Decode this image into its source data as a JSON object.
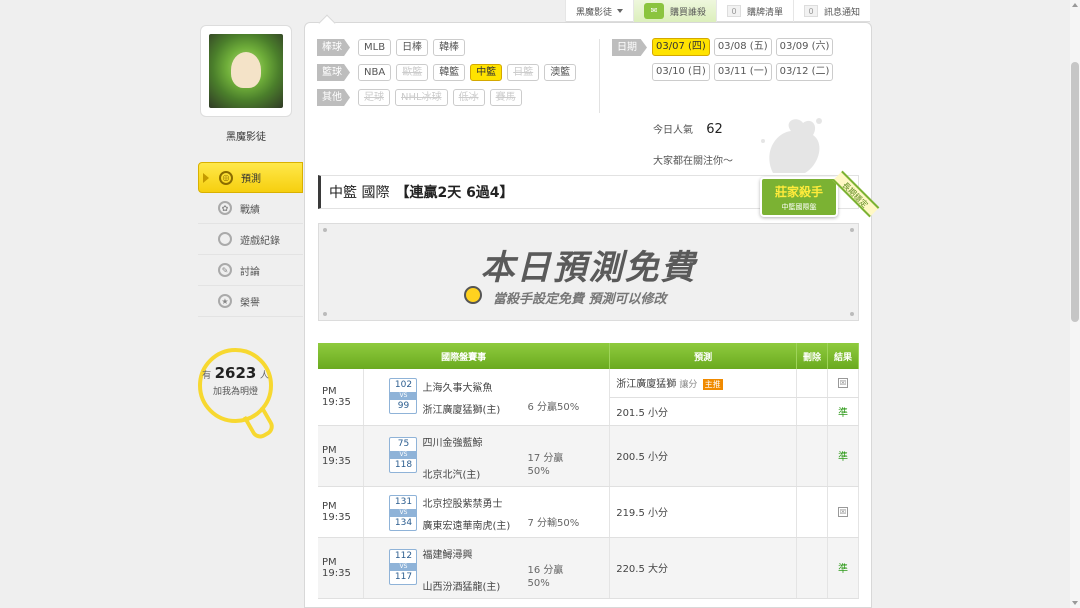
{
  "topbar": {
    "user_menu_label": "黑魔影徒",
    "buy_label": "購買誰殺",
    "cart_count": "0",
    "cart_label": "購牌清單",
    "notice_count": "0",
    "notice_label": "訊息通知"
  },
  "sidebar": {
    "username": "黑魔影徒",
    "nav": [
      {
        "label": "預測",
        "icon": "target-icon",
        "active": true
      },
      {
        "label": "戰績",
        "icon": "medal-icon",
        "active": false
      },
      {
        "label": "遊戲紀錄",
        "icon": "record-icon",
        "active": false
      },
      {
        "label": "討論",
        "icon": "discussion-icon",
        "active": false
      },
      {
        "label": "榮譽",
        "icon": "honor-icon",
        "active": false
      }
    ],
    "fans": {
      "prefix": "有",
      "count": "2623",
      "suffix": "人",
      "sub": "加我為明燈"
    }
  },
  "filters": {
    "baseball": {
      "label": "棒球",
      "items": [
        "MLB",
        "日棒",
        "韓棒"
      ]
    },
    "basketball": {
      "label": "籃球",
      "items": [
        "NBA",
        "歐籃",
        "韓籃",
        "中籃",
        "日籃",
        "澳籃"
      ],
      "disabled": [
        "歐籃",
        "日籃"
      ],
      "selected": "中籃"
    },
    "other": {
      "label": "其他",
      "items": [
        "足球",
        "NHL冰球",
        "低冰",
        "賽馬"
      ],
      "disabled": [
        "足球",
        "NHL冰球",
        "低冰",
        "賽馬"
      ]
    }
  },
  "dates": {
    "label": "日期",
    "items": [
      "03/07 (四)",
      "03/08 (五)",
      "03/09 (六)",
      "03/10 (日)",
      "03/11 (一)",
      "03/12 (二)"
    ],
    "selected": "03/07 (四)"
  },
  "stats": {
    "popularity_label": "今日人氣",
    "popularity_value": "62",
    "watch_text": "大家都在關注你～"
  },
  "section": {
    "league": "中籃 國際",
    "streak": "【連贏2天 6過4】",
    "badge_title": "莊家殺手",
    "badge_sub": "中籃國際盤",
    "badge_corner": "長期穩定"
  },
  "banner": {
    "title": "本日預測免費",
    "subtitle": "當殺手設定免費 預測可以修改"
  },
  "table": {
    "headers": [
      "國際盤賽事",
      "預測",
      "刪除",
      "結果"
    ],
    "games": [
      {
        "time": "PM 19:35",
        "score_away": "102",
        "score_home": "99",
        "away": "上海久事大鯊魚",
        "home": "浙江廣廈猛獅(主)",
        "odds": "6 分贏50%",
        "predictions": [
          {
            "text": "浙江廣廈猛獅",
            "extra": "讓分",
            "tag": "主推",
            "result": "fail"
          },
          {
            "text": "201.5 小分",
            "extra": "",
            "tag": "",
            "result": "準"
          }
        ]
      },
      {
        "time": "PM 19:35",
        "score_away": "75",
        "score_home": "118",
        "away": "四川金強藍鯨",
        "home": "北京北汽(主)",
        "odds": "17 分贏\n50%",
        "predictions": [
          {
            "text": "200.5 小分",
            "extra": "",
            "tag": "",
            "result": "準"
          }
        ]
      },
      {
        "time": "PM 19:35",
        "score_away": "131",
        "score_home": "134",
        "away": "北京控股紫禁勇士",
        "home": "廣東宏遠華南虎(主)",
        "odds": "7 分輸50%",
        "predictions": [
          {
            "text": "219.5 小分",
            "extra": "",
            "tag": "",
            "result": "fail"
          }
        ]
      },
      {
        "time": "PM 19:35",
        "score_away": "112",
        "score_home": "117",
        "away": "福建鱘潯興",
        "home": "山西汾酒猛龍(主)",
        "odds": "16 分贏\n50%",
        "predictions": [
          {
            "text": "220.5 大分",
            "extra": "",
            "tag": "",
            "result": "準"
          }
        ]
      }
    ]
  },
  "colors": {
    "accent_yellow": "#ffe300",
    "header_green": "#7bb82c",
    "win_green": "#2e9a19"
  }
}
